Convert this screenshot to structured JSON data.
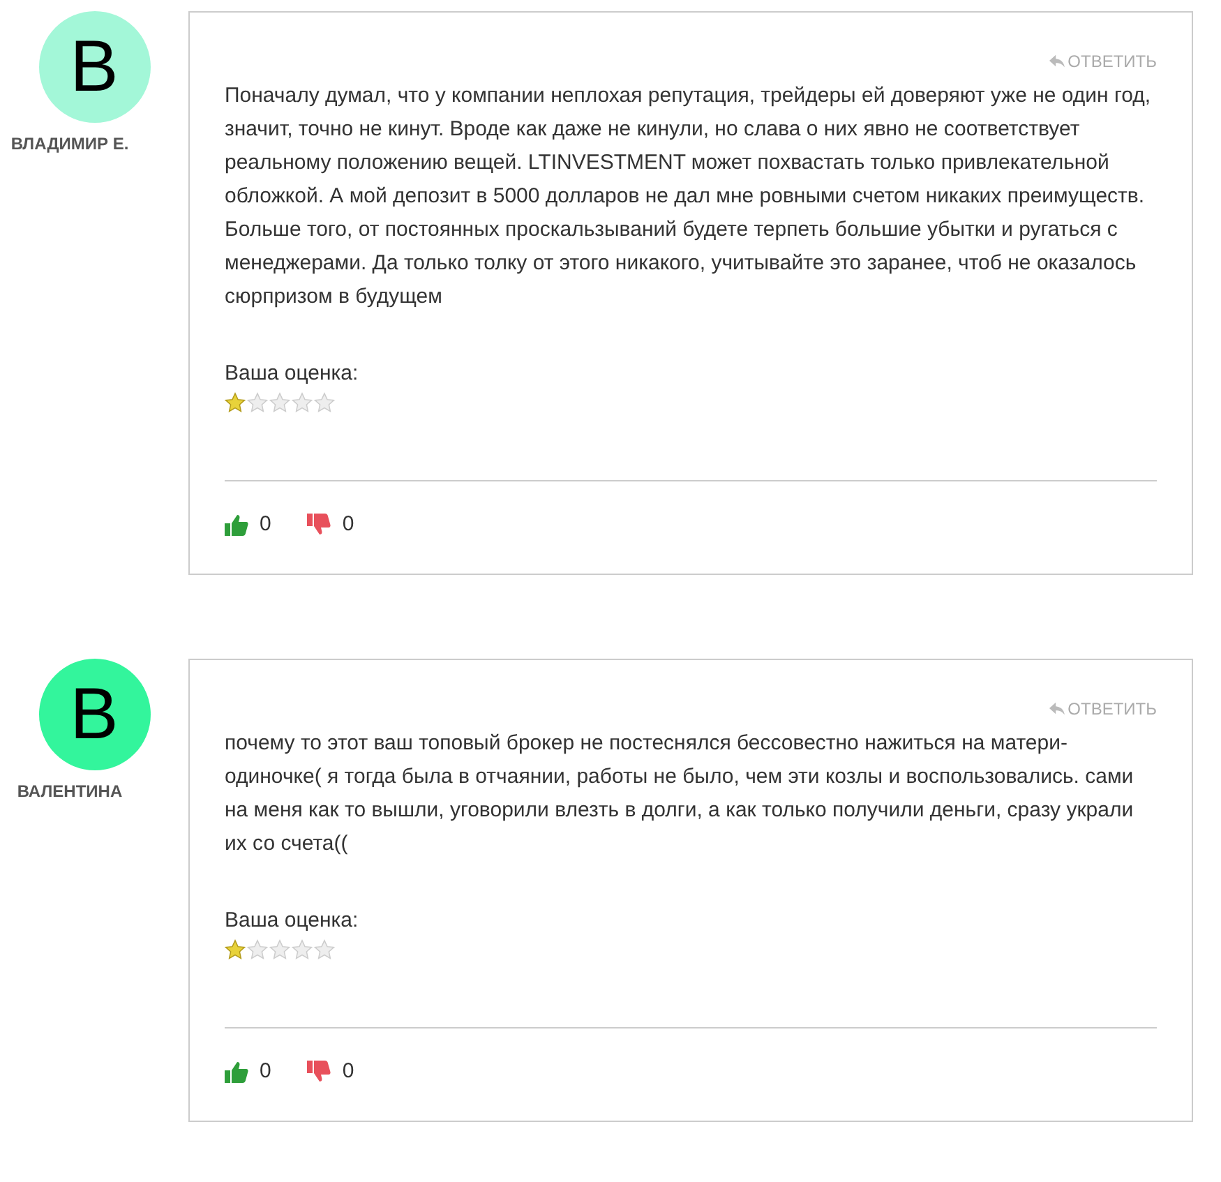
{
  "reviews": [
    {
      "author": "ВЛАДИМИР Е.",
      "avatar_letter": "В",
      "color": "#a3f7d8",
      "reply": "ОТВЕТИТЬ",
      "text": "Поначалу думал, что у компании неплохая репутация, трейдеры ей доверяют уже не один год, значит, точно не кинут. Вроде как даже не кинули, но слава о них явно не соответствует реальному положению вещей. LTINVESTMENT может похвастать только привлекательной обложкой. А мой депозит в 5000 долларов не дал мне ровными счетом никаких преимуществ. Больше того, от постоянных проскальзываний будете терпеть большие убытки и ругаться с менеджерами. Да только толку от этого никакого, учитывайте это заранее, чтоб не оказалось сюрпризом в будущем",
      "rating_label": "Ваша оценка:",
      "stars": 1,
      "likes": "0",
      "dislikes": "0"
    },
    {
      "author": "ВАЛЕНТИНА",
      "avatar_letter": "В",
      "color": "#33f59c",
      "reply": "ОТВЕТИТЬ",
      "text": "почему то этот ваш топовый брокер не постеснялся бессовестно нажиться на матери-одиночке( я тогда была в отчаянии, работы не было, чем эти козлы и воспользовались. сами на меня как то вышли, уговорили влезть в долги, а как только получили деньги, сразу украли их со счета((",
      "rating_label": "Ваша оценка:",
      "stars": 1,
      "likes": "0",
      "dislikes": "0"
    }
  ]
}
